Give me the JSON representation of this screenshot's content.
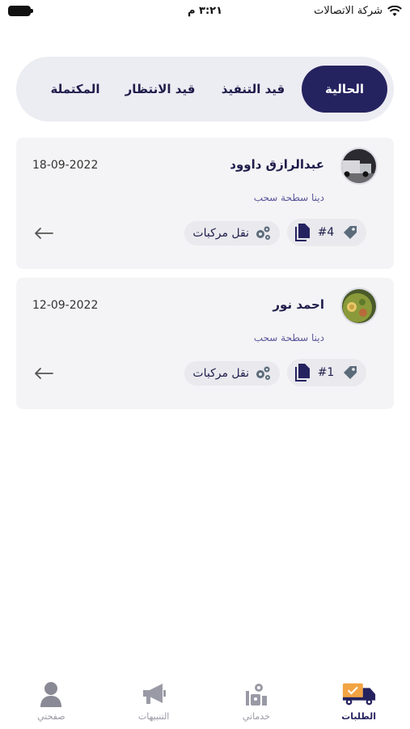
{
  "status_bar": {
    "carrier": "شركة الاتصالات",
    "time": "٣:٢١ م"
  },
  "tabs": [
    {
      "label": "الحالية",
      "active": true
    },
    {
      "label": "قيد التنفيذ",
      "active": false
    },
    {
      "label": "قيد الانتظار",
      "active": false
    },
    {
      "label": "المكتملة",
      "active": false
    }
  ],
  "orders": [
    {
      "customer_name": "عبدالرازق داوود",
      "date": "18-09-2022",
      "service": "دينا سطحة سحب",
      "ref": "#4",
      "category": "نقل مركبات",
      "avatar": "truck-photo"
    },
    {
      "customer_name": "احمد نور",
      "date": "12-09-2022",
      "service": "دينا سطحة سحب",
      "ref": "#1",
      "category": "نقل مركبات",
      "avatar": "food-photo"
    }
  ],
  "bottom_nav": [
    {
      "label": "الطلبات",
      "icon": "delivery-truck-icon",
      "active": true
    },
    {
      "label": "خدماتي",
      "icon": "services-icon",
      "active": false
    },
    {
      "label": "التنبيهات",
      "icon": "megaphone-icon",
      "active": false
    },
    {
      "label": "صفحتي",
      "icon": "user-icon",
      "active": false
    }
  ],
  "colors": {
    "primary": "#25235f",
    "tab_bg": "#ececf3",
    "card_bg": "#f4f4f6",
    "accent": "#f2a443"
  }
}
